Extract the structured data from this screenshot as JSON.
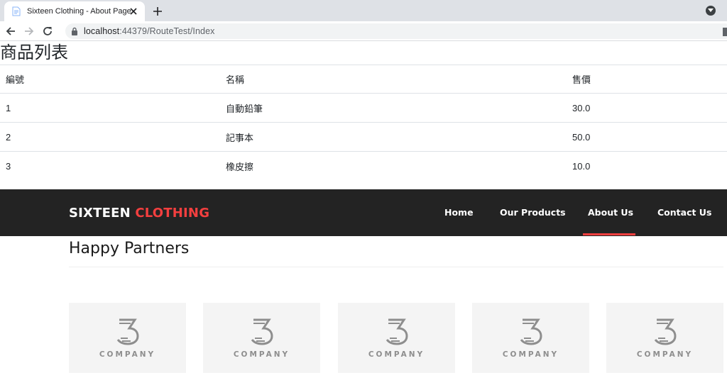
{
  "browser": {
    "tab_title": "Sixteen Clothing - About Page",
    "url_host": "localhost",
    "url_path": ":44379/RouteTest/Index"
  },
  "product_list": {
    "heading": "商品列表",
    "columns": [
      "編號",
      "名稱",
      "售價"
    ],
    "rows": [
      [
        "1",
        "自動鉛筆",
        "30.0"
      ],
      [
        "2",
        "記事本",
        "50.0"
      ],
      [
        "3",
        "橡皮擦",
        "10.0"
      ]
    ]
  },
  "site": {
    "brand_primary": "SIXTEEN",
    "brand_accent": "CLOTHING",
    "nav": [
      "Home",
      "Our Products",
      "About Us",
      "Contact Us"
    ],
    "active_nav": "About Us",
    "colors": {
      "header_bg": "#232323",
      "accent": "#f33f3f"
    }
  },
  "partners": {
    "title": "Happy Partners",
    "logos": [
      "COMPANY",
      "COMPANY",
      "COMPANY",
      "COMPANY",
      "COMPANY"
    ]
  }
}
